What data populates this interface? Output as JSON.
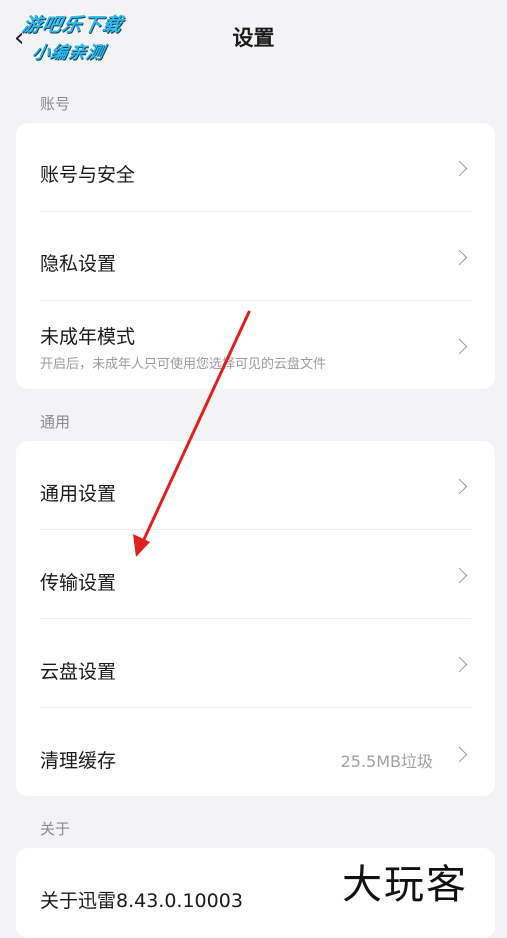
{
  "header": {
    "title": "设置",
    "back_icon": "back-arrow-icon"
  },
  "watermark_top": {
    "line1": "游吧乐下载",
    "line2": "小编亲测"
  },
  "sections": {
    "account": {
      "label": "账号",
      "items": [
        {
          "label": "账号与安全"
        },
        {
          "label": "隐私设置"
        },
        {
          "label": "未成年模式",
          "sub": "开启后，未成年人只可使用您选择可见的云盘文件"
        }
      ]
    },
    "general": {
      "label": "通用",
      "items": [
        {
          "label": "通用设置"
        },
        {
          "label": "传输设置"
        },
        {
          "label": "云盘设置"
        },
        {
          "label": "清理缓存",
          "value": "25.5MB垃圾"
        }
      ]
    },
    "about": {
      "label": "关于",
      "items": [
        {
          "label": "关于迅雷8.43.0.10003"
        }
      ]
    }
  },
  "annotation": {
    "arrow_color": "#e0201c"
  },
  "watermark_bottom": "大玩客"
}
